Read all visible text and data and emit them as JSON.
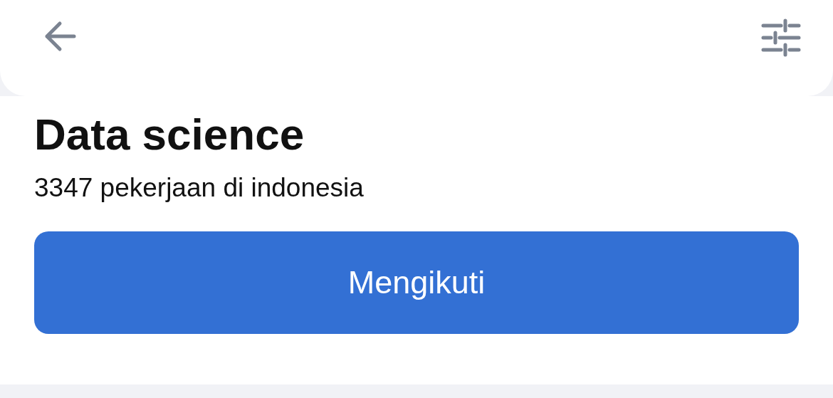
{
  "header": {
    "title": "Data science",
    "subtitle": "3347 pekerjaan di indonesia"
  },
  "follow_button": {
    "label": "Mengikuti"
  }
}
